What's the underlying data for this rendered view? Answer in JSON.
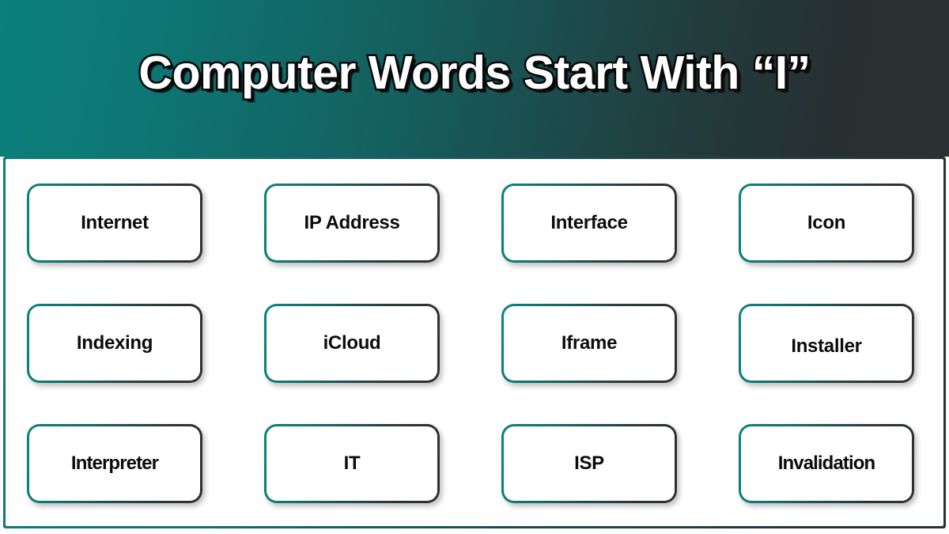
{
  "header": {
    "title": "Computer Words Start With “I”",
    "gradient_from": "#0c7f7b",
    "gradient_to": "#2a3132",
    "title_color": "#ffffff",
    "title_outline_color": "#0a0a0a"
  },
  "panel": {
    "background": "#ffffff",
    "border_gradient_from": "#0c7f7b",
    "border_gradient_to": "#2a3132"
  },
  "cards": [
    {
      "label": "Internet"
    },
    {
      "label": "IP Address"
    },
    {
      "label": "Interface"
    },
    {
      "label": "Icon"
    },
    {
      "label": "Indexing"
    },
    {
      "label": "iCloud"
    },
    {
      "label": "Iframe"
    },
    {
      "label": "Installer"
    },
    {
      "label": "Interpreter"
    },
    {
      "label": "IT"
    },
    {
      "label": "ISP"
    },
    {
      "label": "Invalidation"
    }
  ],
  "layout": {
    "columns": 4,
    "rows": 3,
    "total_cards": 12
  }
}
